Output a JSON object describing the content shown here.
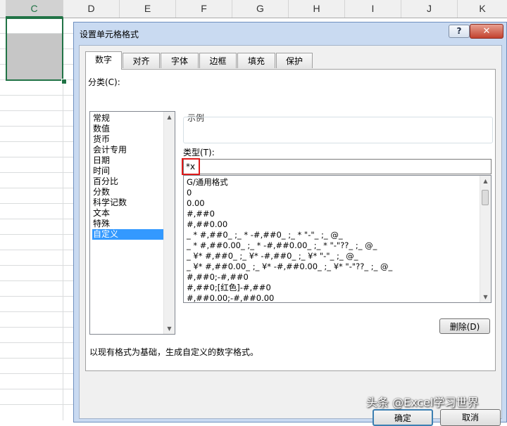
{
  "sheet": {
    "columns": [
      "C",
      "D",
      "E",
      "F",
      "G",
      "H",
      "I",
      "J",
      "K"
    ],
    "selected_column": "C"
  },
  "dialog": {
    "title": "设置单元格格式",
    "help_label": "?",
    "close_label": "✕",
    "tabs": [
      {
        "label": "数字",
        "active": true
      },
      {
        "label": "对齐",
        "active": false
      },
      {
        "label": "字体",
        "active": false
      },
      {
        "label": "边框",
        "active": false
      },
      {
        "label": "填充",
        "active": false
      },
      {
        "label": "保护",
        "active": false
      }
    ],
    "category_label": "分类(C):",
    "categories": [
      "常规",
      "数值",
      "货币",
      "会计专用",
      "日期",
      "时间",
      "百分比",
      "分数",
      "科学记数",
      "文本",
      "特殊",
      "自定义"
    ],
    "selected_category": "自定义",
    "sample_label": "示例",
    "type_label": "类型(T):",
    "type_value": "*x",
    "formats": [
      "G/通用格式",
      "0",
      "0.00",
      "#,##0",
      "#,##0.00",
      "_ * #,##0_ ;_ * -#,##0_ ;_ * \"-\"_ ;_ @_",
      "_ * #,##0.00_ ;_ * -#,##0.00_ ;_ * \"-\"??_ ;_ @_",
      "_ ¥* #,##0_ ;_ ¥* -#,##0_ ;_ ¥* \"-\"_ ;_ @_",
      "_ ¥* #,##0.00_ ;_ ¥* -#,##0.00_ ;_ ¥* \"-\"??_ ;_ @_",
      "#,##0;-#,##0",
      "#,##0;[红色]-#,##0",
      "#,##0.00;-#,##0.00"
    ],
    "delete_label": "删除(D)",
    "description": "以现有格式为基础，生成自定义的数字格式。",
    "ok_label": "确定",
    "cancel_label": "取消"
  },
  "watermark": "头条 @Excel学习世界",
  "colors": {
    "excel_green": "#217346",
    "selection_blue": "#3399ff",
    "highlight_red": "#e01b1b",
    "dialog_frame": "#c9daf1"
  }
}
